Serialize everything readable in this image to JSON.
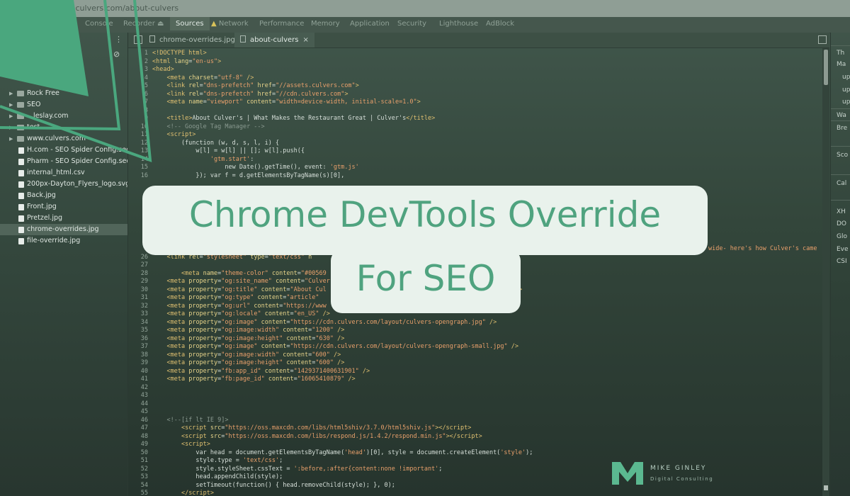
{
  "browser": {
    "url": "...culvers.com/about-culvers"
  },
  "devtools": {
    "tabs": [
      {
        "label": "Console"
      },
      {
        "label": "Recorder"
      },
      {
        "label": "Sources",
        "active": true
      },
      {
        "label": "Network"
      },
      {
        "label": "Performance"
      },
      {
        "label": "Memory"
      },
      {
        "label": "Application"
      },
      {
        "label": "Security"
      },
      {
        "label": "Lighthouse"
      },
      {
        "label": "AdBlock"
      }
    ]
  },
  "sidebar": {
    "items": [
      {
        "name": "Rock Free",
        "type": "folder"
      },
      {
        "name": "SEO",
        "type": "folder"
      },
      {
        "name": "...leslay.com",
        "type": "folder"
      },
      {
        "name": "test",
        "type": "folder"
      },
      {
        "name": "www.culvers.com",
        "type": "folder"
      },
      {
        "name": "H.com - SEO Spider Config.seosp",
        "type": "file"
      },
      {
        "name": "Pharm - SEO Spider Config.seosp",
        "type": "file"
      },
      {
        "name": "internal_html.csv",
        "type": "file"
      },
      {
        "name": "200px-Dayton_Flyers_logo.svg.pn",
        "type": "file"
      },
      {
        "name": "Back.jpg",
        "type": "file"
      },
      {
        "name": "Front.jpg",
        "type": "file"
      },
      {
        "name": "Pretzel.jpg",
        "type": "file"
      },
      {
        "name": "chrome-overrides.jpg",
        "type": "file",
        "selected": true
      },
      {
        "name": "file-override.jpg",
        "type": "file"
      }
    ]
  },
  "editor": {
    "tabs": [
      {
        "label": "chrome-overrides.jpg"
      },
      {
        "label": "about-culvers",
        "active": true
      }
    ],
    "lines": [
      {
        "n": "1",
        "h": "<span class='t'>&lt;!DOCTYPE html&gt;</span>"
      },
      {
        "n": "2",
        "h": "<span class='t'>&lt;html</span> <span class='a'>lang</span>=<span class='s'>\"en-us\"</span><span class='t'>&gt;</span>"
      },
      {
        "n": "3",
        "h": "<span class='t'>&lt;head&gt;</span>"
      },
      {
        "n": "4",
        "h": "    <span class='t'>&lt;meta</span> <span class='a'>charset</span>=<span class='s'>\"utf-8\"</span> <span class='t'>/&gt;</span>"
      },
      {
        "n": "5",
        "h": "    <span class='t'>&lt;link</span> <span class='a'>rel</span>=<span class='s'>\"dns-prefetch\"</span> <span class='a'>href</span>=<span class='s'>\"//assets.culvers.com\"</span><span class='t'>&gt;</span>"
      },
      {
        "n": "6",
        "h": "    <span class='t'>&lt;link</span> <span class='a'>rel</span>=<span class='s'>\"dns-prefetch\"</span> <span class='a'>href</span>=<span class='s'>\"//cdn.culvers.com\"</span><span class='t'>&gt;</span>"
      },
      {
        "n": "7",
        "h": "    <span class='t'>&lt;meta</span> <span class='a'>name</span>=<span class='s'>\"viewport\"</span> <span class='a'>content</span>=<span class='s'>\"width=device-width, initial-scale=1.0\"</span><span class='t'>&gt;</span>"
      },
      {
        "n": "8",
        "h": ""
      },
      {
        "n": "9",
        "h": "    <span class='t'>&lt;title&gt;</span>About Culver's | What Makes the Restaurant Great | Culver's<span class='t'>&lt;/title&gt;</span>"
      },
      {
        "n": "10",
        "h": "    <span class='c'>&lt;!-- Google Tag Manager --&gt;</span>"
      },
      {
        "n": "11",
        "h": "    <span class='t'>&lt;script&gt;</span>"
      },
      {
        "n": "12",
        "h": "        (function (w, d, s, l, i) {"
      },
      {
        "n": "13",
        "h": "            w[l] = w[l] || []; w[l].push({"
      },
      {
        "n": "14",
        "h": "                <span class='s'>'gtm.start'</span>:"
      },
      {
        "n": "15",
        "h": "                    new Date().getTime(), event: <span class='s'>'gtm.js'</span>"
      },
      {
        "n": "16",
        "h": "            }); var f = d.getElementsByTagName(s)[0],"
      },
      {
        "n": "26",
        "h": "    <span class='t'>&lt;link</span> <span class='a'>rel</span>=<span class='s'>\"stylesheet\"</span> <span class='a'>type</span>=<span class='s'>\"text/css\"</span> <span class='a'>h</span>"
      },
      {
        "n": "27",
        "h": ""
      },
      {
        "n": "28",
        "h": "        <span class='t'>&lt;meta</span> <span class='a'>name</span>=<span class='s'>\"theme-color\"</span> <span class='a'>content</span>=<span class='s'>\"#00569</span>"
      },
      {
        "n": "29",
        "h": "    <span class='t'>&lt;meta</span> <span class='a'>property</span>=<span class='s'>\"og:site_name\"</span> <span class='a'>content</span>=<span class='s'>\"Culver</span>"
      },
      {
        "n": "30",
        "h": "    <span class='t'>&lt;meta</span> <span class='a'>property</span>=<span class='s'>\"og:title\"</span> <span class='a'>content</span>=<span class='s'>\"About Cul</span>                                           <span class='s'>r&amp;#39;s\"</span> <span class='t'>/&gt;</span>"
      },
      {
        "n": "31",
        "h": "    <span class='t'>&lt;meta</span> <span class='a'>property</span>=<span class='s'>\"og:type\"</span> <span class='a'>content</span>=<span class='s'>\"article\"</span>"
      },
      {
        "n": "32",
        "h": "    <span class='t'>&lt;meta</span> <span class='a'>property</span>=<span class='s'>\"og:url\"</span> <span class='a'>content</span>=<span class='s'>\"https://www</span>"
      },
      {
        "n": "33",
        "h": "    <span class='t'>&lt;meta</span> <span class='a'>property</span>=<span class='s'>\"og:locale\"</span> <span class='a'>content</span>=<span class='s'>\"en_US\"</span> <span class='t'>/&gt;</span>"
      },
      {
        "n": "34",
        "h": "    <span class='t'>&lt;meta</span> <span class='a'>property</span>=<span class='s'>\"og:image\"</span> <span class='a'>content</span>=<span class='s'>\"https://cdn.culvers.com/layout/culvers-opengraph.jpg\"</span> <span class='t'>/&gt;</span>"
      },
      {
        "n": "35",
        "h": "    <span class='t'>&lt;meta</span> <span class='a'>property</span>=<span class='s'>\"og:image:width\"</span> <span class='a'>content</span>=<span class='s'>\"1200\"</span> <span class='t'>/&gt;</span>"
      },
      {
        "n": "36",
        "h": "    <span class='t'>&lt;meta</span> <span class='a'>property</span>=<span class='s'>\"og:image:height\"</span> <span class='a'>content</span>=<span class='s'>\"630\"</span> <span class='t'>/&gt;</span>"
      },
      {
        "n": "37",
        "h": "    <span class='t'>&lt;meta</span> <span class='a'>property</span>=<span class='s'>\"og:image\"</span> <span class='a'>content</span>=<span class='s'>\"https://cdn.culvers.com/layout/culvers-opengraph-small.jpg\"</span> <span class='t'>/&gt;</span>"
      },
      {
        "n": "38",
        "h": "    <span class='t'>&lt;meta</span> <span class='a'>property</span>=<span class='s'>\"og:image:width\"</span> <span class='a'>content</span>=<span class='s'>\"600\"</span> <span class='t'>/&gt;</span>"
      },
      {
        "n": "39",
        "h": "    <span class='t'>&lt;meta</span> <span class='a'>property</span>=<span class='s'>\"og:image:height\"</span> <span class='a'>content</span>=<span class='s'>\"600\"</span> <span class='t'>/&gt;</span>"
      },
      {
        "n": "40",
        "h": "    <span class='t'>&lt;meta</span> <span class='a'>property</span>=<span class='s'>\"fb:app_id\"</span> <span class='a'>content</span>=<span class='s'>\"1429371400631901\"</span> <span class='t'>/&gt;</span>"
      },
      {
        "n": "41",
        "h": "    <span class='t'>&lt;meta</span> <span class='a'>property</span>=<span class='s'>\"fb:page_id\"</span> <span class='a'>content</span>=<span class='s'>\"16065410879\"</span> <span class='t'>/&gt;</span>"
      },
      {
        "n": "42",
        "h": ""
      },
      {
        "n": "43",
        "h": ""
      },
      {
        "n": "44",
        "h": ""
      },
      {
        "n": "45",
        "h": ""
      },
      {
        "n": "46",
        "h": "    <span class='c'>&lt;!--[if lt IE 9]&gt;</span>"
      },
      {
        "n": "47",
        "h": "        <span class='t'>&lt;script</span> <span class='a'>src</span>=<span class='s'>\"https://oss.maxcdn.com/libs/html5shiv/3.7.0/html5shiv.js\"</span><span class='t'>&gt;&lt;/script&gt;</span>"
      },
      {
        "n": "48",
        "h": "        <span class='t'>&lt;script</span> <span class='a'>src</span>=<span class='s'>\"https://oss.maxcdn.com/libs/respond.js/1.4.2/respond.min.js\"</span><span class='t'>&gt;&lt;/script&gt;</span>"
      },
      {
        "n": "49",
        "h": "        <span class='t'>&lt;script&gt;</span>"
      },
      {
        "n": "50",
        "h": "            var head = document.getElementsByTagName(<span class='s'>'head'</span>)[0], style = document.createElement(<span class='s'>'style'</span>);"
      },
      {
        "n": "51",
        "h": "            style.type = <span class='s'>'text/css'</span>;"
      },
      {
        "n": "52",
        "h": "            style.styleSheet.cssText = <span class='s'>':before,:after{content:none !important'</span>;"
      },
      {
        "n": "53",
        "h": "            head.appendChild(style);"
      },
      {
        "n": "54",
        "h": "            setTimeout(function() { head.removeChild(style); }, 0);"
      },
      {
        "n": "55",
        "h": "        <span class='t'>&lt;/script&gt;</span>"
      }
    ],
    "bleed_text": "wide- here's how Culver's came"
  },
  "right_panel": {
    "items": [
      {
        "label": "Th"
      },
      {
        "label": "Ma"
      },
      {
        "label": "up"
      },
      {
        "label": "up"
      },
      {
        "label": "up"
      },
      {
        "label": "Wa"
      },
      {
        "label": "Bre"
      },
      {
        "label": "Sco"
      },
      {
        "label": "Cal"
      },
      {
        "label": "XH"
      },
      {
        "label": "DO"
      },
      {
        "label": "Glo"
      },
      {
        "label": "Eve"
      },
      {
        "label": "CSI"
      }
    ]
  },
  "overlay": {
    "title_line1": "Chrome DevTools Override",
    "title_line2": "For SEO"
  },
  "logo": {
    "name": "MIKE GINLEY",
    "sub": "Digital Consulting"
  },
  "colors": {
    "accent": "#4fa37f",
    "card": "#e9f2ec",
    "background": "#33463b"
  }
}
